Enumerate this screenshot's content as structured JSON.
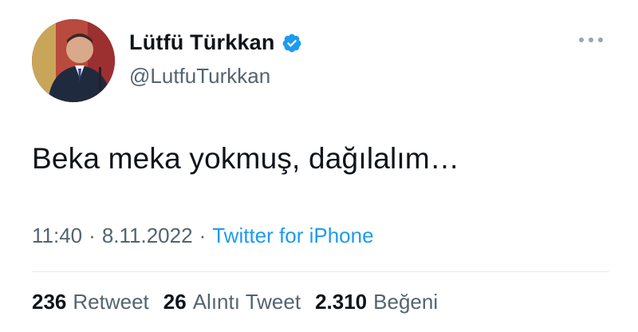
{
  "author": {
    "display_name": "Lütfü Türkkan",
    "handle": "@LutfuTurkkan",
    "verified": true,
    "avatar_icon": "profile-photo"
  },
  "tweet": {
    "text": "Beka meka yokmuş, dağılalım…",
    "time": "11:40",
    "date": "8.11.2022",
    "source": "Twitter for iPhone",
    "separator": "·"
  },
  "stats": {
    "retweets": {
      "count": "236",
      "label": "Retweet"
    },
    "quotes": {
      "count": "26",
      "label": "Alıntı Tweet"
    },
    "likes": {
      "count": "2.310",
      "label": "Beğeni"
    }
  },
  "colors": {
    "text": "#0f1419",
    "secondary": "#536471",
    "link": "#1d9bf0",
    "verified": "#1d9bf0"
  }
}
